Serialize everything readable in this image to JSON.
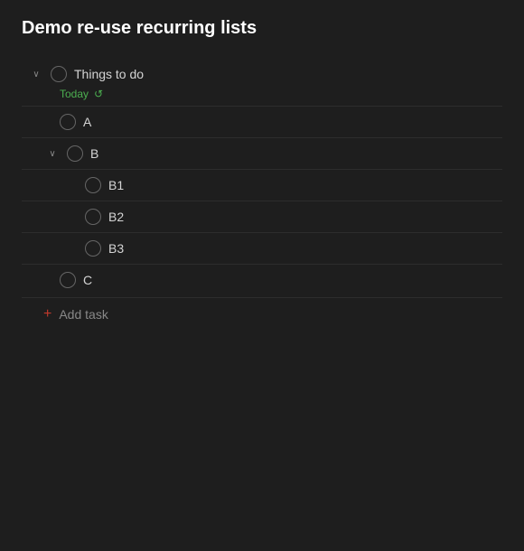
{
  "title": "Demo re-use recurring lists",
  "list": {
    "name": "Things to do",
    "today_label": "Today",
    "recur_symbol": "↺",
    "tasks": [
      {
        "id": "A",
        "label": "A",
        "indent": "task"
      },
      {
        "id": "B",
        "label": "B",
        "indent": "group",
        "expanded": true,
        "subtasks": [
          {
            "id": "B1",
            "label": "B1"
          },
          {
            "id": "B2",
            "label": "B2"
          },
          {
            "id": "B3",
            "label": "B3"
          }
        ]
      },
      {
        "id": "C",
        "label": "C",
        "indent": "task"
      }
    ],
    "add_task_label": "Add task"
  },
  "icons": {
    "chevron_down": "∨",
    "plus": "+"
  }
}
